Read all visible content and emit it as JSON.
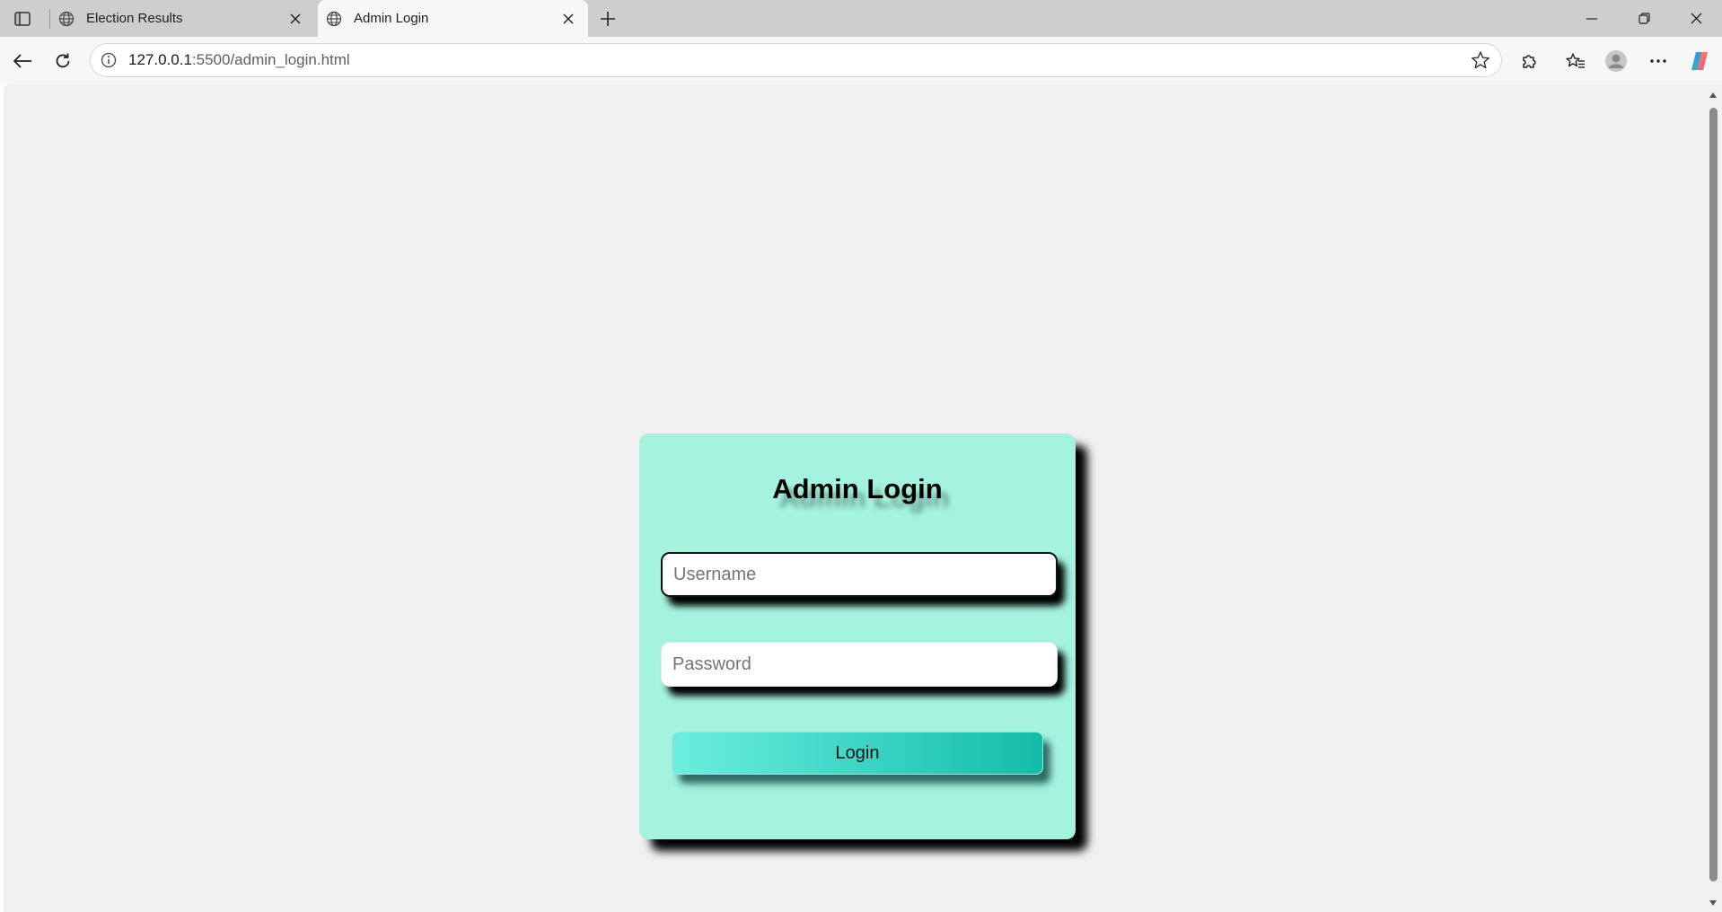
{
  "browser": {
    "tabs": [
      {
        "title": "Election Results",
        "active": false
      },
      {
        "title": "Admin Login",
        "active": true
      }
    ],
    "address_bar": {
      "url_host": "127.0.0.1",
      "url_rest": ":5500/admin_login.html"
    },
    "icons": {
      "sidebar_toggle": "sidebar-toggle-icon",
      "new_tab": "plus-icon",
      "back": "back-arrow-icon",
      "reload": "reload-icon",
      "site_info": "info-icon",
      "favorite": "star-icon",
      "extensions": "puzzle-icon",
      "favorites": "favorites-icon",
      "profile": "profile-icon",
      "more": "more-icon",
      "copilot": "copilot-icon"
    }
  },
  "page": {
    "background_color": "#f0f0f0",
    "card_color": "#a3f3df",
    "login": {
      "title": "Admin Login",
      "username_placeholder": "Username",
      "password_placeholder": "Password",
      "button_label": "Login"
    }
  }
}
